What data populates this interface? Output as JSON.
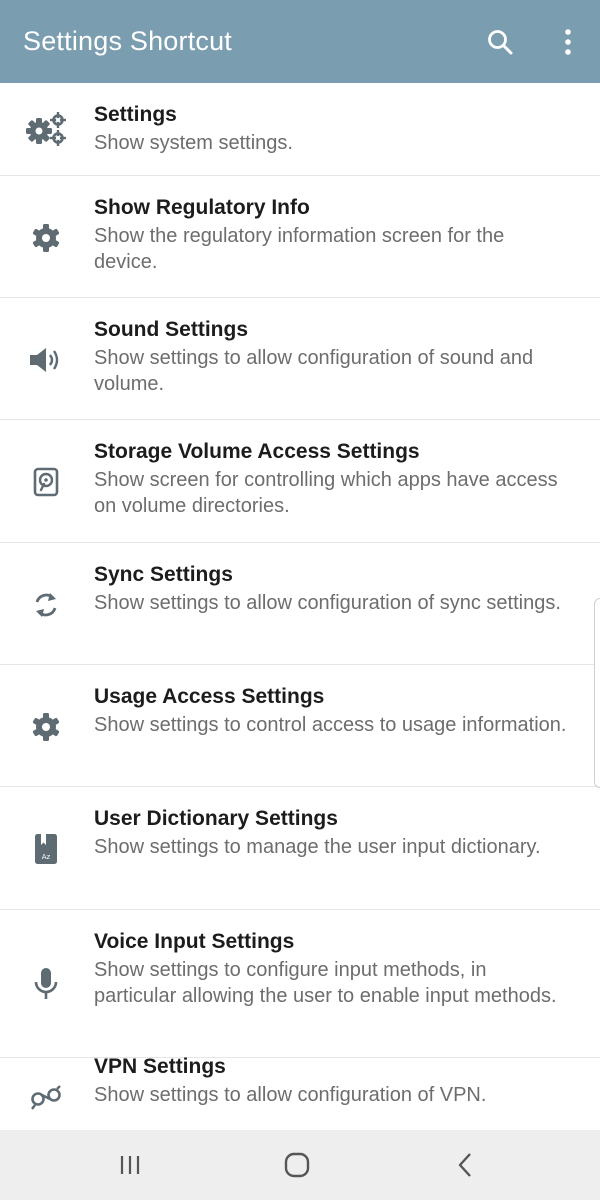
{
  "app_bar": {
    "title": "Settings Shortcut",
    "background": "#7a9db0",
    "actions": [
      "search-icon",
      "more-vert-icon"
    ]
  },
  "items": [
    {
      "title": "Settings",
      "description": "Show system settings.",
      "icon": "gears-icon"
    },
    {
      "title": "Show Regulatory Info",
      "description": "Show the regulatory information screen for the device.",
      "icon": "gear-icon"
    },
    {
      "title": "Sound Settings",
      "description": "Show settings to allow configuration of sound and volume.",
      "icon": "speaker-icon"
    },
    {
      "title": "Storage Volume Access Settings",
      "description": "Show screen for controlling which apps have access on volume directories.",
      "icon": "storage-icon"
    },
    {
      "title": "Sync Settings",
      "description": "Show settings to allow configuration of sync settings.",
      "icon": "sync-icon"
    },
    {
      "title": "Usage Access Settings",
      "description": "Show settings to control access to usage information.",
      "icon": "gear-icon"
    },
    {
      "title": "User Dictionary Settings",
      "description": "Show settings to manage the user input dictionary.",
      "icon": "dictionary-icon"
    },
    {
      "title": "Voice Input Settings",
      "description": "Show settings to configure input methods, in particular allowing the user to enable input methods.",
      "icon": "microphone-icon"
    },
    {
      "title": "VPN Settings",
      "description": "Show settings to allow configuration of VPN.",
      "icon": "vpn-key-icon"
    }
  ],
  "nav_bar": {
    "buttons": [
      "recent-apps-icon",
      "home-icon",
      "back-icon"
    ]
  }
}
